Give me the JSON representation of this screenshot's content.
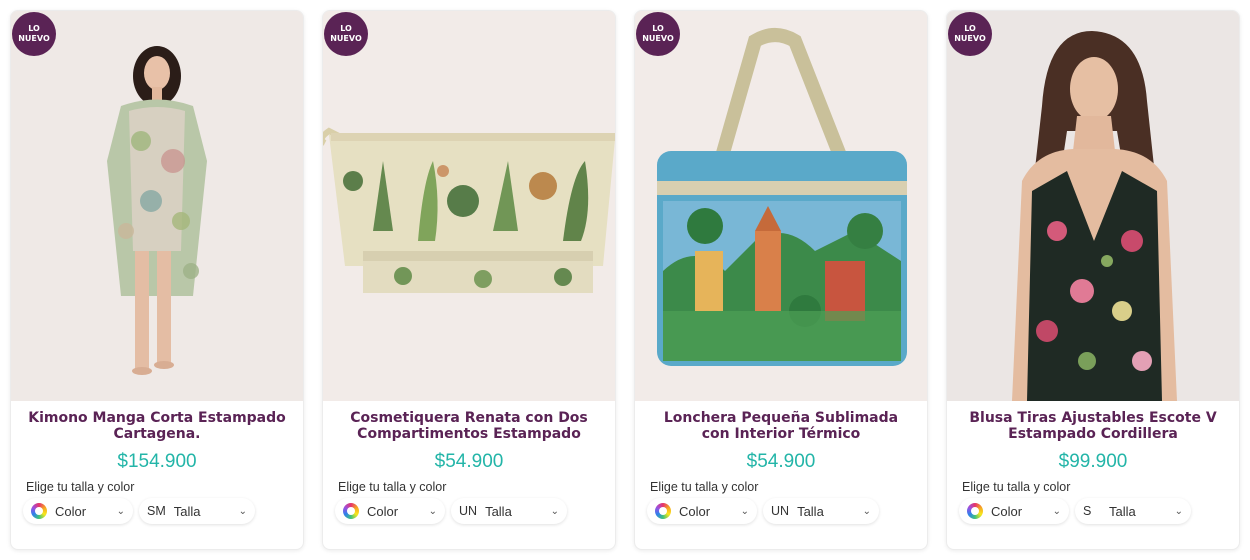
{
  "badge": {
    "line1": "LO",
    "line2": "NUEVO"
  },
  "size_label": "Elige tu talla y color",
  "color_label": "Color",
  "size_placeholder": "Talla",
  "products": [
    {
      "name": "Kimono Manga Corta Estampado Cartagena.",
      "price": "$154.900",
      "size_code": "SM"
    },
    {
      "name": "Cosmetiquera Renata con Dos Compartimentos Estampado",
      "price": "$54.900",
      "size_code": "UN"
    },
    {
      "name": "Lonchera Pequeña Sublimada con Interior Térmico",
      "price": "$54.900",
      "size_code": "UN"
    },
    {
      "name": "Blusa Tiras Ajustables Escote V Estampado Cordillera",
      "price": "$99.900",
      "size_code": "S"
    }
  ],
  "colors": {
    "brand": "#5a2355",
    "price": "#23b5a8"
  }
}
